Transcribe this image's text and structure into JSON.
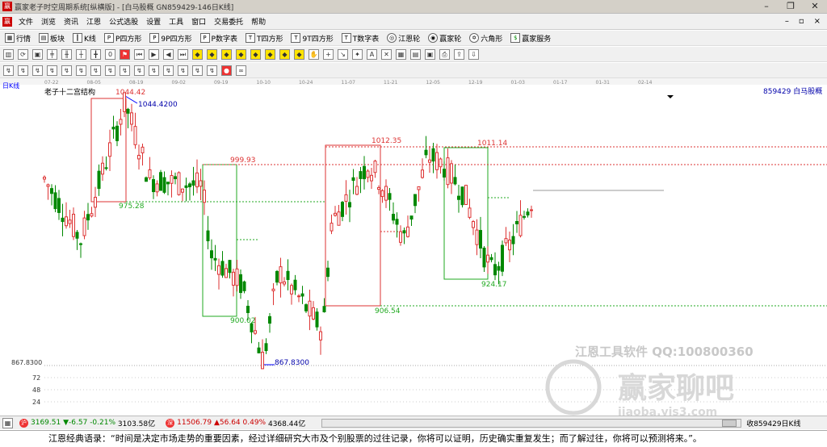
{
  "window": {
    "title": "赢家老子时空周期系统[纵横版] - [白马股概 GN859429-146日K线]"
  },
  "menu": [
    "文件",
    "浏览",
    "资讯",
    "江恩",
    "公式选股",
    "设置",
    "工具",
    "窗口",
    "交易委托",
    "帮助"
  ],
  "toolbar1": [
    {
      "icon": "market-icon",
      "label": "行情"
    },
    {
      "icon": "sector-icon",
      "label": "板块"
    },
    {
      "icon": "kline-icon",
      "label": "K线"
    },
    {
      "icon": "p-square-icon",
      "label": "P四方形"
    },
    {
      "icon": "9p-square-icon",
      "label": "9P四方形"
    },
    {
      "icon": "p-number-table-icon",
      "label": "P数字表"
    },
    {
      "icon": "t-square-icon",
      "label": "T四方形"
    },
    {
      "icon": "9t-square-icon",
      "label": "9T四方形"
    },
    {
      "icon": "t-number-table-icon",
      "label": "T数字表"
    },
    {
      "icon": "gann-wheel-icon",
      "label": "江恩轮"
    },
    {
      "icon": "winner-wheel-icon",
      "label": "赢家轮"
    },
    {
      "icon": "hexagon-icon",
      "label": "六角形"
    },
    {
      "icon": "winner-service-icon",
      "label": "赢家服务"
    }
  ],
  "chart": {
    "period_label": "日K线",
    "indicator_title": "老子十二宫结构",
    "code_label": "859429  白马股概",
    "date_ticks": [
      "07-22",
      "08-05",
      "08-19",
      "09-02",
      "09-19",
      "10-10",
      "10-24",
      "11-07",
      "11-21",
      "12-05",
      "12-19",
      "01-03",
      "01-17",
      "01-31",
      "02-14"
    ],
    "price_labels": {
      "high_top": "1044.42",
      "high_mark": "1044.4200",
      "box1_low": "975.28",
      "box2_high": "999.93",
      "box2_low": "900.02",
      "low_mark": "867.8300",
      "left_low": "867.8300",
      "box3_high": "1012.35",
      "box3_low": "906.54",
      "box4_high": "1011.14",
      "box4_low": "924.17"
    },
    "volume_axis": [
      "72",
      "48",
      "24"
    ]
  },
  "watermark": {
    "line1": "江恩工具软件  QQ:100800360",
    "logo": "赢家聊吧",
    "url": "jiaoba.yjs3.com"
  },
  "status": {
    "sh_value": "3169.51",
    "sh_change": "▼-6.57",
    "sh_pct": "-0.21%",
    "sh_amount": "3103.58亿",
    "sz_value": "11506.79",
    "sz_change": "▲56.64",
    "sz_pct": "0.49%",
    "sz_amount": "4368.44亿",
    "right_label": "收859429日K线"
  },
  "quote": "江恩经典语录：“时间是决定市场走势的重要因素，经过详细研究大市及个别股票的过往记录，你将可以证明，历史确实重复发生；而了解过往，你将可以预测将来。”。"
}
